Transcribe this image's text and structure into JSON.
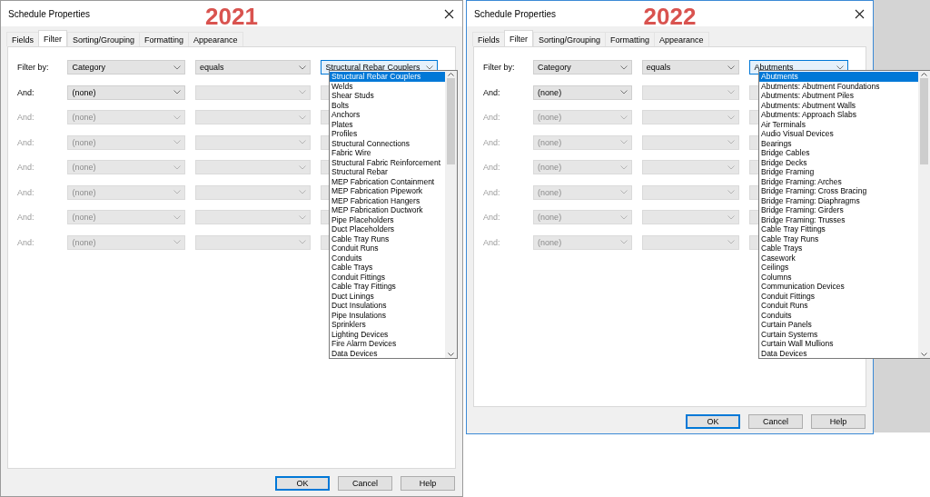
{
  "dialogs": [
    {
      "title": "Schedule Properties",
      "annotation": "2021",
      "tabs": [
        {
          "label": "Fields",
          "selected": false
        },
        {
          "label": "Filter",
          "selected": true
        },
        {
          "label": "Sorting/Grouping",
          "selected": false
        },
        {
          "label": "Formatting",
          "selected": false
        },
        {
          "label": "Appearance",
          "selected": false
        }
      ],
      "filters": [
        {
          "label": "Filter by:",
          "disabled": false,
          "field": "Category",
          "operator": "equals",
          "value": "Structural Rebar Couplers",
          "open": true
        },
        {
          "label": "And:",
          "disabled": false,
          "field": "(none)",
          "open": false
        },
        {
          "label": "And:",
          "disabled": true,
          "field": "(none)",
          "open": false
        },
        {
          "label": "And:",
          "disabled": true,
          "field": "(none)",
          "open": false
        },
        {
          "label": "And:",
          "disabled": true,
          "field": "(none)",
          "open": false
        },
        {
          "label": "And:",
          "disabled": true,
          "field": "(none)",
          "open": false
        },
        {
          "label": "And:",
          "disabled": true,
          "field": "(none)",
          "open": false
        },
        {
          "label": "And:",
          "disabled": true,
          "field": "(none)",
          "open": false
        }
      ],
      "dropdown": [
        {
          "label": "Structural Rebar Couplers",
          "selected": true
        },
        {
          "label": "Welds",
          "selected": false
        },
        {
          "label": "Shear Studs",
          "selected": false
        },
        {
          "label": "Bolts",
          "selected": false
        },
        {
          "label": "Anchors",
          "selected": false
        },
        {
          "label": "Plates",
          "selected": false
        },
        {
          "label": "Profiles",
          "selected": false
        },
        {
          "label": "Structural Connections",
          "selected": false
        },
        {
          "label": "Fabric Wire",
          "selected": false
        },
        {
          "label": "Structural Fabric Reinforcement",
          "selected": false
        },
        {
          "label": "Structural Rebar",
          "selected": false
        },
        {
          "label": "MEP Fabrication Containment",
          "selected": false
        },
        {
          "label": "MEP Fabrication Pipework",
          "selected": false
        },
        {
          "label": "MEP Fabrication Hangers",
          "selected": false
        },
        {
          "label": "MEP Fabrication Ductwork",
          "selected": false
        },
        {
          "label": "Pipe Placeholders",
          "selected": false
        },
        {
          "label": "Duct Placeholders",
          "selected": false
        },
        {
          "label": "Cable Tray Runs",
          "selected": false
        },
        {
          "label": "Conduit Runs",
          "selected": false
        },
        {
          "label": "Conduits",
          "selected": false
        },
        {
          "label": "Cable Trays",
          "selected": false
        },
        {
          "label": "Conduit Fittings",
          "selected": false
        },
        {
          "label": "Cable Tray Fittings",
          "selected": false
        },
        {
          "label": "Duct Linings",
          "selected": false
        },
        {
          "label": "Duct Insulations",
          "selected": false
        },
        {
          "label": "Pipe Insulations",
          "selected": false
        },
        {
          "label": "Sprinklers",
          "selected": false
        },
        {
          "label": "Lighting Devices",
          "selected": false
        },
        {
          "label": "Fire Alarm Devices",
          "selected": false
        },
        {
          "label": "Data Devices",
          "selected": false
        }
      ],
      "buttons": [
        {
          "label": "OK",
          "default": true
        },
        {
          "label": "Cancel",
          "default": false
        },
        {
          "label": "Help",
          "default": false
        }
      ]
    },
    {
      "title": "Schedule Properties",
      "annotation": "2022",
      "tabs": [
        {
          "label": "Fields",
          "selected": false
        },
        {
          "label": "Filter",
          "selected": true
        },
        {
          "label": "Sorting/Grouping",
          "selected": false
        },
        {
          "label": "Formatting",
          "selected": false
        },
        {
          "label": "Appearance",
          "selected": false
        }
      ],
      "filters": [
        {
          "label": "Filter by:",
          "disabled": false,
          "field": "Category",
          "operator": "equals",
          "value": "Abutments",
          "open": true
        },
        {
          "label": "And:",
          "disabled": false,
          "field": "(none)",
          "open": false
        },
        {
          "label": "And:",
          "disabled": true,
          "field": "(none)",
          "open": false
        },
        {
          "label": "And:",
          "disabled": true,
          "field": "(none)",
          "open": false
        },
        {
          "label": "And:",
          "disabled": true,
          "field": "(none)",
          "open": false
        },
        {
          "label": "And:",
          "disabled": true,
          "field": "(none)",
          "open": false
        },
        {
          "label": "And:",
          "disabled": true,
          "field": "(none)",
          "open": false
        },
        {
          "label": "And:",
          "disabled": true,
          "field": "(none)",
          "open": false
        }
      ],
      "dropdown": [
        {
          "label": "Abutments",
          "selected": true
        },
        {
          "label": "Abutments: Abutment Foundations",
          "selected": false
        },
        {
          "label": "Abutments: Abutment Piles",
          "selected": false
        },
        {
          "label": "Abutments: Abutment Walls",
          "selected": false
        },
        {
          "label": "Abutments: Approach Slabs",
          "selected": false
        },
        {
          "label": "Air Terminals",
          "selected": false
        },
        {
          "label": "Audio Visual Devices",
          "selected": false
        },
        {
          "label": "Bearings",
          "selected": false
        },
        {
          "label": "Bridge Cables",
          "selected": false
        },
        {
          "label": "Bridge Decks",
          "selected": false
        },
        {
          "label": "Bridge Framing",
          "selected": false
        },
        {
          "label": "Bridge Framing: Arches",
          "selected": false
        },
        {
          "label": "Bridge Framing: Cross Bracing",
          "selected": false
        },
        {
          "label": "Bridge Framing: Diaphragms",
          "selected": false
        },
        {
          "label": "Bridge Framing: Girders",
          "selected": false
        },
        {
          "label": "Bridge Framing: Trusses",
          "selected": false
        },
        {
          "label": "Cable Tray Fittings",
          "selected": false
        },
        {
          "label": "Cable Tray Runs",
          "selected": false
        },
        {
          "label": "Cable Trays",
          "selected": false
        },
        {
          "label": "Casework",
          "selected": false
        },
        {
          "label": "Ceilings",
          "selected": false
        },
        {
          "label": "Columns",
          "selected": false
        },
        {
          "label": "Communication Devices",
          "selected": false
        },
        {
          "label": "Conduit Fittings",
          "selected": false
        },
        {
          "label": "Conduit Runs",
          "selected": false
        },
        {
          "label": "Conduits",
          "selected": false
        },
        {
          "label": "Curtain Panels",
          "selected": false
        },
        {
          "label": "Curtain Systems",
          "selected": false
        },
        {
          "label": "Curtain Wall Mullions",
          "selected": false
        },
        {
          "label": "Data Devices",
          "selected": false
        }
      ],
      "buttons": [
        {
          "label": "OK",
          "default": true
        },
        {
          "label": "Cancel",
          "default": false
        },
        {
          "label": "Help",
          "default": false
        }
      ]
    }
  ]
}
